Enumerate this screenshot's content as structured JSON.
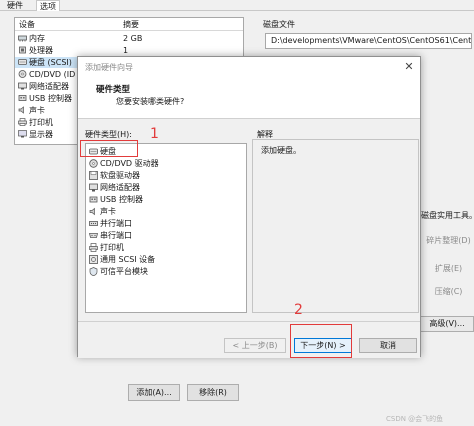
{
  "background_window": {
    "tabs": [
      "硬件",
      "选项"
    ],
    "device_table": {
      "headers": [
        "设备",
        "摘要"
      ],
      "rows": [
        {
          "icon": "memory-icon",
          "label": "内存",
          "value": "2 GB"
        },
        {
          "icon": "cpu-icon",
          "label": "处理器",
          "value": "1"
        },
        {
          "icon": "disk-icon",
          "label": "硬盘 (SCSI)",
          "value": "",
          "selected": true
        },
        {
          "icon": "cd-icon",
          "label": "CD/DVD (ID",
          "value": ""
        },
        {
          "icon": "network-icon",
          "label": "网络适配器",
          "value": ""
        },
        {
          "icon": "usb-icon",
          "label": "USB 控制器",
          "value": ""
        },
        {
          "icon": "sound-icon",
          "label": "声卡",
          "value": ""
        },
        {
          "icon": "printer-icon",
          "label": "打印机",
          "value": ""
        },
        {
          "icon": "display-icon",
          "label": "显示器",
          "value": ""
        }
      ]
    },
    "disk_file_label": "磁盘文件",
    "disk_file_path": "D:\\developments\\VMware\\CentOS\\CentOS61\\CentOS",
    "side_note": "磁盘实用工具。",
    "side_buttons": [
      "碎片整理(D)",
      "扩展(E)",
      "压缩(C)"
    ],
    "advanced_button": "高级(V)...",
    "add_button": "添加(A)...",
    "remove_button": "移除(R)",
    "watermark": "CSDN @会飞的鱼"
  },
  "wizard": {
    "title": "添加硬件向导",
    "header_title": "硬件类型",
    "header_subtitle": "您要安装哪类硬件?",
    "hardware_label": "硬件类型(H):",
    "hardware_types": [
      {
        "icon": "disk-icon",
        "label": "硬盘"
      },
      {
        "icon": "cd-icon",
        "label": "CD/DVD 驱动器"
      },
      {
        "icon": "floppy-icon",
        "label": "软盘驱动器"
      },
      {
        "icon": "network-icon",
        "label": "网络适配器"
      },
      {
        "icon": "usb-icon",
        "label": "USB 控制器"
      },
      {
        "icon": "sound-icon",
        "label": "声卡"
      },
      {
        "icon": "parallel-port-icon",
        "label": "并行端口"
      },
      {
        "icon": "serial-port-icon",
        "label": "串行端口"
      },
      {
        "icon": "printer-icon",
        "label": "打印机"
      },
      {
        "icon": "scsi-icon",
        "label": "通用 SCSI 设备"
      },
      {
        "icon": "tpm-icon",
        "label": "可信平台模块"
      }
    ],
    "explanation_label": "解释",
    "explanation_text": "添加硬盘。",
    "back_button": "< 上一步(B)",
    "next_button": "下一步(N) >",
    "cancel_button": "取消",
    "close_glyph": "✕"
  },
  "annotations": {
    "step1": "1",
    "step2": "2",
    "color": "#e23b3b"
  }
}
